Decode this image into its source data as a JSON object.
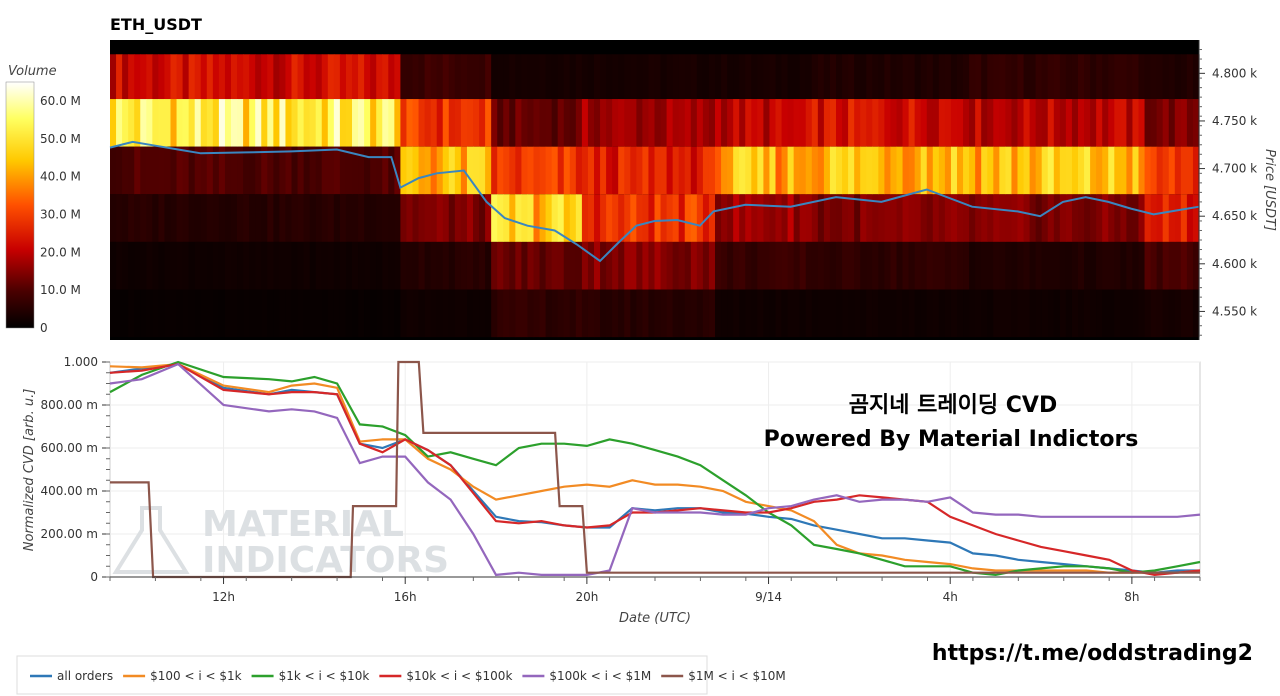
{
  "chart_data": [
    {
      "type": "heatmap",
      "title": "ETH_USDT",
      "ylabel": "Price [USDT]",
      "ylim": [
        4520,
        4835
      ],
      "y_ticks": [
        {
          "value": 4800,
          "label": "4.800 k"
        },
        {
          "value": 4750,
          "label": "4.750 k"
        },
        {
          "value": 4700,
          "label": "4.700 k"
        },
        {
          "value": 4650,
          "label": "4.650 k"
        },
        {
          "value": 4600,
          "label": "4.600 k"
        },
        {
          "value": 4550,
          "label": "4.550 k"
        }
      ],
      "price_bands": [
        4820,
        4773,
        4723,
        4673,
        4623,
        4573,
        4523
      ],
      "colorbar": {
        "title": "Volume",
        "range": [
          0,
          65
        ],
        "ticks": [
          {
            "value": 60,
            "label": "60.0 M"
          },
          {
            "value": 50,
            "label": "50.0 M"
          },
          {
            "value": 40,
            "label": "40.0 M"
          },
          {
            "value": 30,
            "label": "30.0 M"
          },
          {
            "value": 20,
            "label": "20.0 M"
          },
          {
            "value": 10,
            "label": "10.0 M"
          },
          {
            "value": 0,
            "label": "0"
          }
        ]
      },
      "volume_segments": [
        {
          "from": 0,
          "to": 6.3,
          "bands": [
            22,
            52,
            10,
            5,
            2,
            1
          ]
        },
        {
          "from": 6.3,
          "to": 8.3,
          "bands": [
            8,
            28,
            42,
            14,
            5,
            2
          ]
        },
        {
          "from": 8.3,
          "to": 10.3,
          "bands": [
            3,
            12,
            28,
            45,
            12,
            6
          ]
        },
        {
          "from": 10.3,
          "to": 13.3,
          "bands": [
            3,
            17,
            25,
            28,
            15,
            5
          ]
        },
        {
          "from": 13.3,
          "to": 15.4,
          "bands": [
            3,
            20,
            42,
            17,
            7,
            2
          ]
        },
        {
          "from": 15.4,
          "to": 18.9,
          "bands": [
            4,
            23,
            45,
            14,
            6,
            2
          ]
        },
        {
          "from": 18.9,
          "to": 22.7,
          "bands": [
            6,
            20,
            44,
            14,
            4,
            2
          ]
        },
        {
          "from": 22.7,
          "to": 24.0,
          "bands": [
            4,
            14,
            28,
            25,
            9,
            3
          ]
        }
      ],
      "price_series": {
        "name": "price",
        "color": "#3a86c0",
        "x": [
          0,
          0.5,
          1.0,
          1.5,
          2.0,
          3.0,
          4.0,
          5.0,
          5.7,
          6.2,
          6.4,
          6.8,
          7.2,
          7.8,
          8.3,
          8.7,
          9.2,
          9.8,
          10.3,
          10.8,
          11.2,
          11.6,
          12.0,
          12.5,
          13.0,
          13.3,
          14.0,
          15.0,
          16.0,
          17.0,
          18.0,
          19.0,
          20.0,
          20.5,
          21.0,
          21.5,
          22.0,
          22.5,
          23.0,
          23.5,
          24.0
        ],
        "y": [
          4722,
          4728,
          4724,
          4720,
          4716,
          4717,
          4718,
          4720,
          4712,
          4712,
          4680,
          4690,
          4695,
          4698,
          4665,
          4648,
          4640,
          4635,
          4620,
          4603,
          4622,
          4640,
          4645,
          4646,
          4640,
          4655,
          4662,
          4660,
          4670,
          4665,
          4678,
          4660,
          4655,
          4650,
          4665,
          4670,
          4665,
          4658,
          4652,
          4656,
          4660
        ]
      }
    },
    {
      "type": "line",
      "xlabel": "Date (UTC)",
      "ylabel": "Normalized CVD [arb. u.]",
      "ylim": [
        0,
        1000
      ],
      "xlim": [
        0,
        24
      ],
      "x_ticks": [
        {
          "value": 2.5,
          "label": "12h"
        },
        {
          "value": 6.5,
          "label": "16h"
        },
        {
          "value": 10.5,
          "label": "20h"
        },
        {
          "value": 14.5,
          "label": "9/14"
        },
        {
          "value": 18.5,
          "label": "4h"
        },
        {
          "value": 22.5,
          "label": "8h"
        }
      ],
      "y_ticks": [
        {
          "value": 0,
          "label": "0"
        },
        {
          "value": 200,
          "label": "200.00 m"
        },
        {
          "value": 400,
          "label": "400.00 m"
        },
        {
          "value": 600,
          "label": "600.00 m"
        },
        {
          "value": 800,
          "label": "800.00 m"
        },
        {
          "value": 1000,
          "label": "1.000"
        }
      ],
      "annotations": [
        "곰지네 트레이딩 CVD",
        "Powered By Material Indictors"
      ],
      "watermark": [
        "MATERIAL",
        "INDICATORS"
      ],
      "series": [
        {
          "name": "all orders",
          "color": "#2e78b7",
          "x": [
            0,
            0.7,
            1.5,
            2.5,
            3.5,
            4.0,
            4.5,
            5.0,
            5.5,
            6.0,
            6.5,
            7.0,
            7.5,
            8.0,
            8.5,
            9.0,
            9.5,
            10.0,
            10.5,
            11.0,
            11.5,
            12.0,
            12.5,
            13.0,
            13.5,
            14.0,
            14.5,
            15.0,
            15.5,
            16.0,
            16.5,
            17.0,
            17.5,
            18.0,
            18.5,
            19.0,
            19.5,
            20.0,
            20.5,
            21.0,
            21.5,
            22.0,
            22.5,
            23.0,
            23.5,
            24.0
          ],
          "y": [
            950,
            970,
            990,
            880,
            850,
            870,
            860,
            850,
            620,
            600,
            640,
            590,
            520,
            400,
            280,
            260,
            255,
            240,
            230,
            230,
            320,
            310,
            320,
            320,
            300,
            295,
            280,
            270,
            240,
            220,
            200,
            180,
            180,
            170,
            160,
            110,
            100,
            80,
            70,
            60,
            50,
            40,
            30,
            20,
            30,
            30
          ]
        },
        {
          "name": "$100 < i < $1k",
          "color": "#f28b24",
          "x": [
            0,
            0.7,
            1.5,
            2.5,
            3.5,
            4.0,
            4.5,
            5.0,
            5.5,
            6.0,
            6.5,
            7.0,
            7.5,
            8.0,
            8.5,
            9.0,
            9.5,
            10.0,
            10.5,
            11.0,
            11.5,
            12.0,
            12.5,
            13.0,
            13.5,
            14.0,
            14.5,
            15.0,
            15.5,
            16.0,
            16.5,
            17.0,
            17.5,
            18.0,
            18.5,
            19.0,
            19.5,
            20.0,
            20.5,
            21.0,
            21.5,
            22.0,
            22.5,
            23.0,
            23.5,
            24.0
          ],
          "y": [
            980,
            975,
            990,
            890,
            860,
            890,
            900,
            880,
            630,
            640,
            640,
            550,
            500,
            420,
            360,
            380,
            400,
            420,
            430,
            420,
            450,
            430,
            430,
            420,
            400,
            350,
            330,
            310,
            260,
            150,
            110,
            100,
            80,
            70,
            60,
            40,
            30,
            30,
            30,
            30,
            30,
            20,
            20,
            20,
            20,
            30
          ]
        },
        {
          "name": "$1k < i < $10k",
          "color": "#2ca02c",
          "x": [
            0,
            0.7,
            1.5,
            2.5,
            3.5,
            4.0,
            4.5,
            5.0,
            5.5,
            6.0,
            6.5,
            7.0,
            7.5,
            8.0,
            8.5,
            9.0,
            9.5,
            10.0,
            10.5,
            11.0,
            11.5,
            12.0,
            12.5,
            13.0,
            13.5,
            14.0,
            14.5,
            15.0,
            15.5,
            16.0,
            16.5,
            17.0,
            17.5,
            18.0,
            18.5,
            19.0,
            19.5,
            20.0,
            20.5,
            21.0,
            21.5,
            22.0,
            22.5,
            23.0,
            23.5,
            24.0
          ],
          "y": [
            860,
            940,
            1000,
            930,
            920,
            910,
            930,
            900,
            710,
            700,
            660,
            560,
            580,
            550,
            520,
            600,
            620,
            620,
            610,
            640,
            620,
            590,
            560,
            520,
            450,
            380,
            300,
            240,
            150,
            130,
            110,
            80,
            50,
            50,
            50,
            20,
            10,
            30,
            40,
            50,
            50,
            40,
            20,
            30,
            50,
            70
          ]
        },
        {
          "name": "$10k < i < $100k",
          "color": "#d62728",
          "x": [
            0,
            0.7,
            1.5,
            2.5,
            3.5,
            4.0,
            4.5,
            5.0,
            5.5,
            6.0,
            6.5,
            7.0,
            7.5,
            8.0,
            8.5,
            9.0,
            9.5,
            10.0,
            10.5,
            11.0,
            11.5,
            12.0,
            12.5,
            13.0,
            13.5,
            14.0,
            14.5,
            15.0,
            15.5,
            16.0,
            16.5,
            17.0,
            17.5,
            18.0,
            18.5,
            19.0,
            19.5,
            20.0,
            20.5,
            21.0,
            21.5,
            22.0,
            22.5,
            23.0,
            23.5,
            24.0
          ],
          "y": [
            950,
            960,
            990,
            870,
            850,
            860,
            860,
            850,
            620,
            580,
            640,
            590,
            520,
            390,
            260,
            250,
            260,
            240,
            230,
            240,
            300,
            300,
            310,
            320,
            310,
            300,
            300,
            320,
            350,
            360,
            380,
            370,
            360,
            350,
            280,
            240,
            200,
            170,
            140,
            120,
            100,
            80,
            30,
            10,
            20,
            30
          ]
        },
        {
          "name": "$100k < i < $1M",
          "color": "#9467bd",
          "x": [
            0,
            0.7,
            1.5,
            2.5,
            3.5,
            4.0,
            4.5,
            5.0,
            5.5,
            6.0,
            6.5,
            7.0,
            7.5,
            8.0,
            8.5,
            9.0,
            9.5,
            10.0,
            10.5,
            11.0,
            11.5,
            12.0,
            12.5,
            13.0,
            13.5,
            14.0,
            14.5,
            15.0,
            15.5,
            16.0,
            16.5,
            17.0,
            17.5,
            18.0,
            18.5,
            19.0,
            19.5,
            20.0,
            20.5,
            21.0,
            21.5,
            22.0,
            22.5,
            23.0,
            23.5,
            24.0
          ],
          "y": [
            900,
            920,
            990,
            800,
            770,
            780,
            770,
            740,
            530,
            560,
            560,
            440,
            360,
            200,
            10,
            20,
            10,
            10,
            10,
            30,
            320,
            300,
            300,
            300,
            290,
            290,
            320,
            330,
            360,
            380,
            350,
            360,
            360,
            350,
            370,
            300,
            290,
            290,
            280,
            280,
            280,
            280,
            280,
            280,
            280,
            290
          ]
        },
        {
          "name": "$1M < i < $10M",
          "color": "#8c564b",
          "x": [
            0,
            0.85,
            0.95,
            5.3,
            5.35,
            6.0,
            6.3,
            6.35,
            6.8,
            6.9,
            7.4,
            7.5,
            9.8,
            9.9,
            10.4,
            10.5,
            24.0
          ],
          "y": [
            440,
            440,
            0,
            0,
            330,
            330,
            330,
            1000,
            1000,
            670,
            670,
            670,
            670,
            330,
            330,
            20,
            20
          ]
        }
      ]
    }
  ],
  "footer": {
    "url": "https://t.me/oddstrading2"
  }
}
